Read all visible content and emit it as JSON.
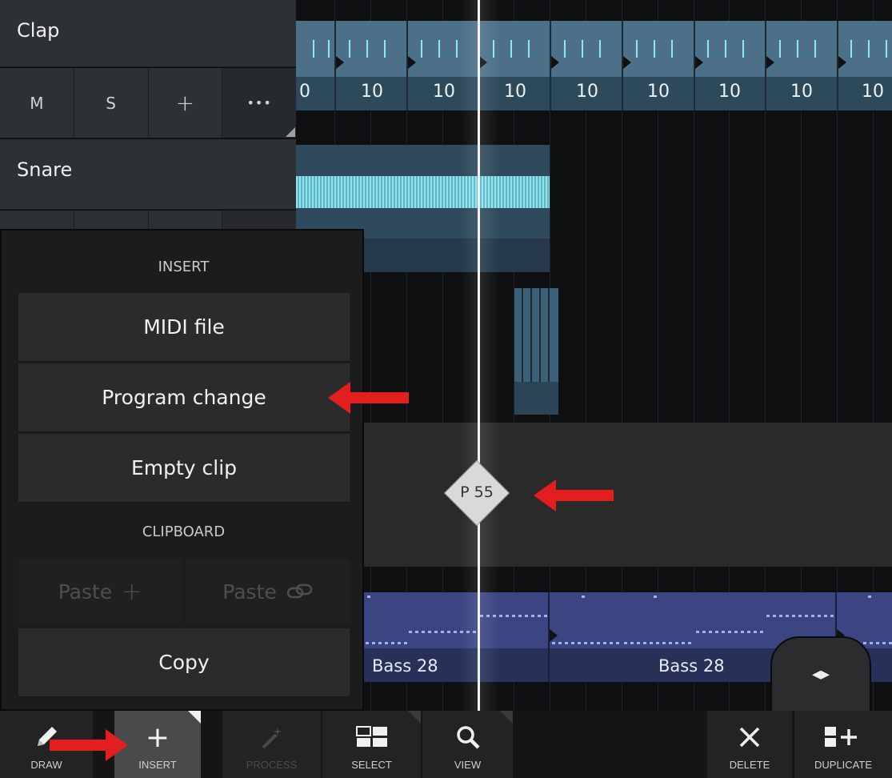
{
  "tracks": [
    {
      "name": "Clap",
      "buttons": {
        "mute": "M",
        "solo": "S",
        "add": "+",
        "more": "•••"
      }
    },
    {
      "name": "Snare"
    }
  ],
  "clap_clip_numbers": [
    "0",
    "10",
    "10",
    "10",
    "10",
    "10",
    "10",
    "10",
    "10"
  ],
  "program_change_marker": "P 55",
  "bass_clips": [
    "Bass   28",
    "Bass   28"
  ],
  "nav_handle_icon": "◂▸",
  "menu": {
    "insert_heading": "INSERT",
    "items": [
      "MIDI file",
      "Program change",
      "Empty clip"
    ],
    "clipboard_heading": "CLIPBOARD",
    "paste_add": "Paste",
    "paste_link": "Paste",
    "copy": "Copy"
  },
  "toolbar": {
    "draw": "DRAW",
    "insert": "INSERT",
    "process": "PROCESS",
    "select": "SELECT",
    "view": "VIEW",
    "delete": "DELETE",
    "duplicate": "DUPLICATE"
  },
  "colors": {
    "clip_accent": "#8fe6f0",
    "bass_clip": "#3a4582",
    "annotation_arrow": "#e31e1e",
    "playhead": "#f2f2f2"
  }
}
